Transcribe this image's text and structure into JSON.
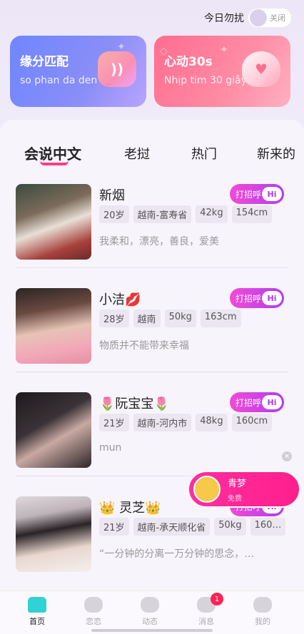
{
  "dnd": {
    "label": "今日勿扰",
    "state": "关闭"
  },
  "banners": [
    {
      "title": "缘分匹配",
      "subtitle": "so phan da den",
      "icon": "chat-bubble-icon"
    },
    {
      "title": "心动30s",
      "subtitle": "Nhịp tim 30 giây",
      "icon": "heart-icon"
    }
  ],
  "tabs": [
    "会说中文",
    "老挝",
    "热门",
    "新来的"
  ],
  "active_tab": 0,
  "greet_button": {
    "label": "打招呼",
    "hi": "Hi"
  },
  "profiles": [
    {
      "name": "新烟",
      "tags": [
        "20岁",
        "越南-富寿省",
        "42kg",
        "154cm"
      ],
      "bio": "我柔和，漂亮，善良，爱美"
    },
    {
      "name": "小洁💋",
      "tags": [
        "28岁",
        "越南",
        "50kg",
        "163cm"
      ],
      "bio": "物质并不能带来幸福"
    },
    {
      "name": "🌷阮宝宝🌷",
      "tags": [
        "21岁",
        "越南-河内市",
        "48kg",
        "160cm"
      ],
      "bio": "mun"
    },
    {
      "name": "👑 灵芝👑",
      "tags": [
        "21岁",
        "越南-承天顺化省",
        "50kg",
        "160…"
      ],
      "bio": "“一分钟的分离一万分钟的思念，…"
    }
  ],
  "popup": {
    "name": "青梦",
    "subtitle": "免费"
  },
  "nav": [
    {
      "label": "首页",
      "icon": "home-icon",
      "active": true
    },
    {
      "label": "恋恋",
      "icon": "heart-pulse-icon"
    },
    {
      "label": "动态",
      "icon": "planet-icon"
    },
    {
      "label": "消息",
      "icon": "message-icon",
      "badge": "1"
    },
    {
      "label": "我的",
      "icon": "profile-icon"
    }
  ],
  "colors": {
    "accent": "#ff3e8a",
    "greet_gradient": [
      "#f24bd4",
      "#b13cf0"
    ],
    "active_nav": "#2fd3d3"
  }
}
